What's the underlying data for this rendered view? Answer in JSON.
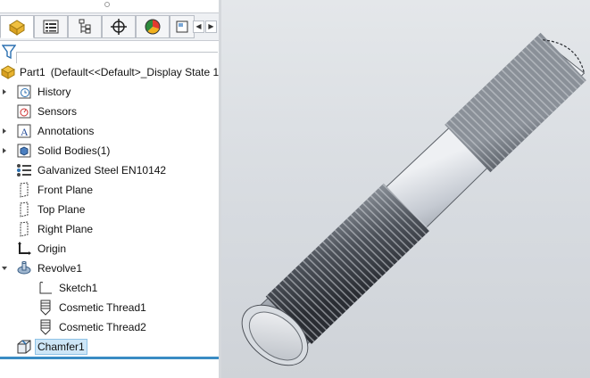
{
  "feature_tree": {
    "part": {
      "name": "Part1",
      "config": "(Default<<Default>_Display State 1>"
    },
    "items": [
      {
        "label": "History",
        "icon": "history-icon",
        "expandable": true
      },
      {
        "label": "Sensors",
        "icon": "sensors-icon",
        "expandable": false
      },
      {
        "label": "Annotations",
        "icon": "annotations-icon",
        "expandable": true
      },
      {
        "label": "Solid Bodies(1)",
        "icon": "solid-bodies-icon",
        "expandable": true
      },
      {
        "label": "Galvanized Steel EN10142",
        "icon": "material-icon",
        "expandable": false
      },
      {
        "label": "Front Plane",
        "icon": "plane-icon",
        "expandable": false
      },
      {
        "label": "Top Plane",
        "icon": "plane-icon",
        "expandable": false
      },
      {
        "label": "Right Plane",
        "icon": "plane-icon",
        "expandable": false
      },
      {
        "label": "Origin",
        "icon": "origin-icon",
        "expandable": false
      },
      {
        "label": "Revolve1",
        "icon": "revolve-icon",
        "expandable": true,
        "expanded": true
      },
      {
        "label": "Sketch1",
        "icon": "sketch-icon",
        "child": true
      },
      {
        "label": "Cosmetic Thread1",
        "icon": "cosmetic-thread-icon",
        "child": true
      },
      {
        "label": "Cosmetic Thread2",
        "icon": "cosmetic-thread-icon",
        "child": true
      },
      {
        "label": "Chamfer1",
        "icon": "chamfer-icon",
        "selected": true
      }
    ]
  },
  "tabs": [
    {
      "name": "featuremanager-tab",
      "icon": "featuremanager-icon",
      "active": true
    },
    {
      "name": "propertymanager-tab",
      "icon": "propertymanager-icon"
    },
    {
      "name": "configurationmanager-tab",
      "icon": "configurationmanager-icon"
    },
    {
      "name": "dimxpertmanager-tab",
      "icon": "dimxpert-icon"
    },
    {
      "name": "displaymanager-tab",
      "icon": "displaymanager-icon"
    }
  ],
  "colors": {
    "selection": "#cde6f7",
    "accent_bar": "#3a8cc4",
    "viewport_bg": "#dcdfe3",
    "thread_dark": "#3c4047",
    "shaft_light": "#c9ced6"
  }
}
